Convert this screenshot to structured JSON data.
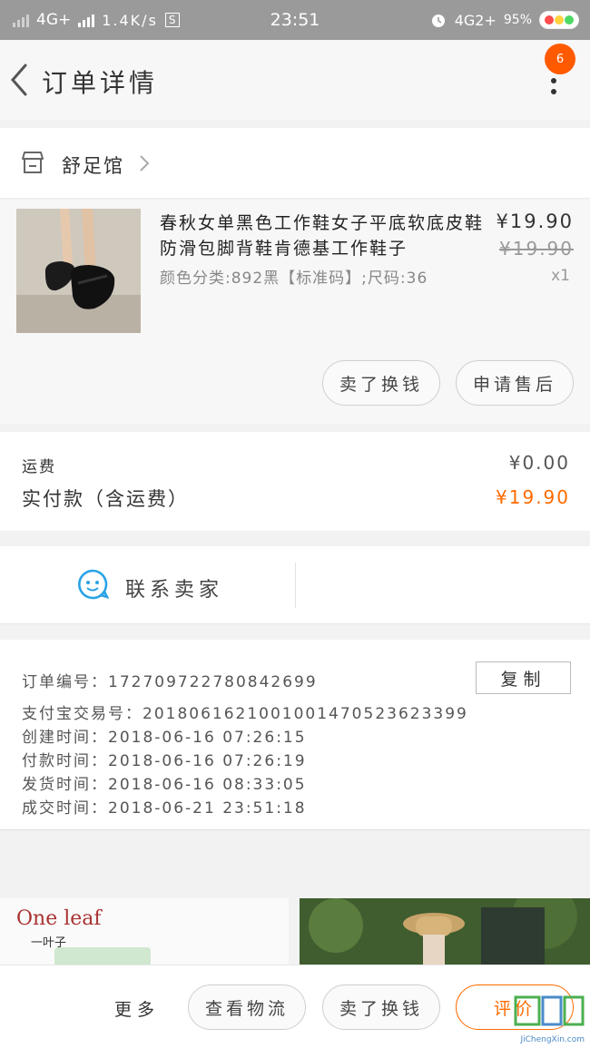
{
  "status_bar": {
    "network_left": "4G+",
    "speed": "1.4K/s",
    "s_icon_label": "S",
    "time": "23:51",
    "network_right": "4G2+",
    "battery": "95%"
  },
  "nav": {
    "title": "订单详情",
    "badge_count": "6"
  },
  "shop": {
    "name": "舒足馆"
  },
  "product": {
    "title": "春秋女单黑色工作鞋女子平底软底皮鞋防滑包脚背鞋肯德基工作鞋子",
    "sku": "颜色分类:892黑【标准码】;尺码:36",
    "price": "¥19.90",
    "original_price": "¥19.90",
    "quantity": "x1",
    "actions": [
      "卖了换钱",
      "申请售后"
    ]
  },
  "cost": {
    "shipping_label": "运费",
    "shipping_value": "¥0.00",
    "paid_label": "实付款（含运费）",
    "paid_value": "¥19.90"
  },
  "contact": {
    "label": "联系卖家"
  },
  "order_info": {
    "lines": [
      "订单编号：172709722780842699",
      "支付宝交易号：2018061621001001470523623399",
      "创建时间：2018-06-16 07:26:15",
      "付款时间：2018-06-16 07:26:19",
      "发货时间：2018-06-16 08:33:05",
      "成交时间：2018-06-21 23:51:18"
    ],
    "copy_label": "复制"
  },
  "ad": {
    "brand": "One leaf",
    "brand_cn": "一叶子"
  },
  "bottom_bar": {
    "more_label": "更多",
    "buttons": [
      "查看物流",
      "卖了换钱",
      "评价"
    ]
  },
  "watermark": {
    "text": "JiChengXin.com"
  },
  "colors": {
    "accent": "#ff6a00",
    "badge": "#ff5a00",
    "contact_icon": "#29a3e6"
  }
}
